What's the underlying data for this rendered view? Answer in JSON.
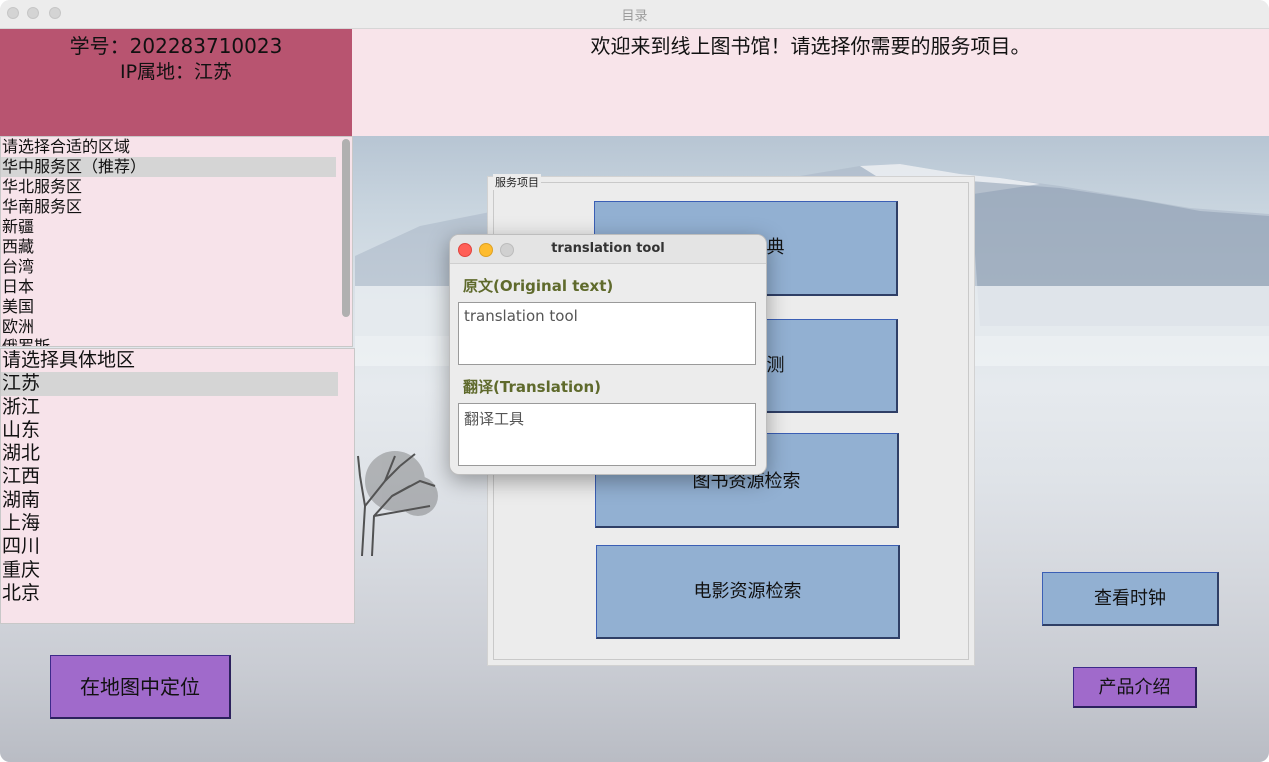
{
  "window": {
    "title": "目录"
  },
  "header": {
    "student_id": "学号：202283710023",
    "ip_location": "IP属地：江苏",
    "welcome": "欢迎来到线上图书馆！请选择你需要的服务项目。"
  },
  "region_list": {
    "items": [
      "请选择合适的区域",
      "华中服务区（推荐）",
      "华北服务区",
      "华南服务区",
      "新疆",
      "西藏",
      "台湾",
      "日本",
      "美国",
      "欧洲",
      "俄罗斯"
    ],
    "selected": "华中服务区（推荐）"
  },
  "area_list": {
    "items": [
      "请选择具体地区",
      "江苏",
      "浙江",
      "山东",
      "湖北",
      "江西",
      "湖南",
      "上海",
      "四川",
      "重庆",
      "北京"
    ],
    "selected": "江苏"
  },
  "services": {
    "legend": "服务项目",
    "buttons": [
      "典",
      "测",
      "图书资源检索",
      "电影资源检索"
    ]
  },
  "buttons": {
    "locate_on_map": "在地图中定位",
    "view_clock": "查看时钟",
    "product_intro": "产品介绍"
  },
  "dialog": {
    "title": "translation tool",
    "original_label": "原文(Original text)",
    "original_text": "translation tool",
    "translation_label": "翻译(Translation)",
    "translation_text": "翻译工具"
  },
  "colors": {
    "student_panel": "#b85470",
    "welcome_panel": "#f8e4ea",
    "service_button": "#92b0d2",
    "purple_button": "#a06acb",
    "dialog_label": "#5f6a2c"
  }
}
